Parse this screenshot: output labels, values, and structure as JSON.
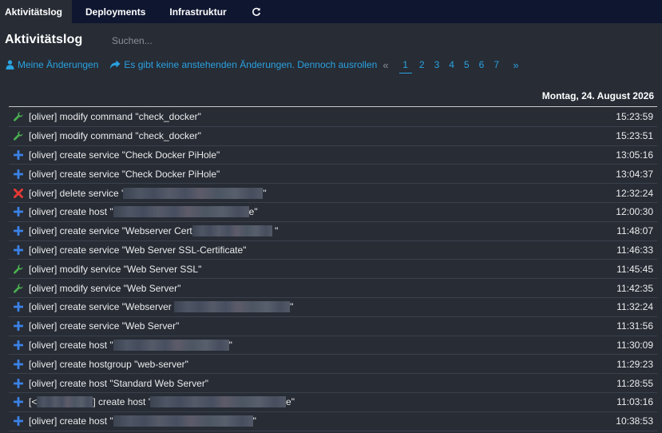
{
  "nav": {
    "tabs": [
      {
        "label": "Aktivitätslog",
        "active": true
      },
      {
        "label": "Deployments",
        "active": false
      },
      {
        "label": "Infrastruktur",
        "active": false
      }
    ],
    "reload_icon": "reload-icon"
  },
  "page": {
    "title": "Aktivitätslog",
    "search_placeholder": "Suchen..."
  },
  "actions": {
    "my_changes": "Meine Änderungen",
    "rollout": "Es gibt keine anstehenden Änderungen. Dennoch ausrollen"
  },
  "pagination": {
    "prev": "«",
    "pages": [
      "1",
      "2",
      "3",
      "4",
      "5",
      "6",
      "7"
    ],
    "current": "1",
    "next": "»"
  },
  "colors": {
    "accent": "#2aa2e0",
    "modify": "#4caf50",
    "create": "#3b82e6",
    "delete": "#e53935"
  },
  "log": {
    "date": "Montag, 24. August 2026",
    "entries": [
      {
        "type": "modify",
        "icon": "wrench-icon",
        "parts": [
          "[oliver] modify command \"check_docker\""
        ],
        "time": "15:23:59"
      },
      {
        "type": "modify",
        "icon": "wrench-icon",
        "parts": [
          "[oliver] modify command \"check_docker\""
        ],
        "time": "15:23:51"
      },
      {
        "type": "create",
        "icon": "plus-icon",
        "parts": [
          "[oliver] create service \"Check Docker PiHole\""
        ],
        "time": "13:05:16"
      },
      {
        "type": "create",
        "icon": "plus-icon",
        "parts": [
          "[oliver] create service \"Check Docker PiHole\""
        ],
        "time": "13:04:37"
      },
      {
        "type": "delete",
        "icon": "x-icon",
        "parts": [
          "[oliver] delete service '",
          "\""
        ],
        "time": "12:32:24"
      },
      {
        "type": "create",
        "icon": "plus-icon",
        "parts": [
          "[oliver] create host \"",
          "e\""
        ],
        "time": "12:00:30"
      },
      {
        "type": "create",
        "icon": "plus-icon",
        "parts": [
          "[oliver] create service \"Webserver Cert",
          " \""
        ],
        "time": "11:48:07"
      },
      {
        "type": "create",
        "icon": "plus-icon",
        "parts": [
          "[oliver] create service \"Web Server SSL-Certificate\""
        ],
        "time": "11:46:33"
      },
      {
        "type": "modify",
        "icon": "wrench-icon",
        "parts": [
          "[oliver] modify service \"Web Server SSL\""
        ],
        "time": "11:45:45"
      },
      {
        "type": "modify",
        "icon": "wrench-icon",
        "parts": [
          "[oliver] modify service \"Web Server\""
        ],
        "time": "11:42:35"
      },
      {
        "type": "create",
        "icon": "plus-icon",
        "parts": [
          "[oliver] create service \"Webserver ",
          "\""
        ],
        "time": "11:32:24"
      },
      {
        "type": "create",
        "icon": "plus-icon",
        "parts": [
          "[oliver] create service \"Web Server\""
        ],
        "time": "11:31:56"
      },
      {
        "type": "create",
        "icon": "plus-icon",
        "parts": [
          "[oliver] create host \"",
          "\""
        ],
        "time": "11:30:09"
      },
      {
        "type": "create",
        "icon": "plus-icon",
        "parts": [
          "[oliver] create hostgroup \"web-server\""
        ],
        "time": "11:29:23"
      },
      {
        "type": "create",
        "icon": "plus-icon",
        "parts": [
          "[oliver] create host \"Standard Web Server\""
        ],
        "time": "11:28:55"
      },
      {
        "type": "create",
        "icon": "plus-icon",
        "parts": [
          "[<",
          "] create host '",
          "e\""
        ],
        "time": "11:03:16"
      },
      {
        "type": "create",
        "icon": "plus-icon",
        "parts": [
          "[oliver] create host \"",
          "\""
        ],
        "time": "10:38:53"
      }
    ]
  }
}
